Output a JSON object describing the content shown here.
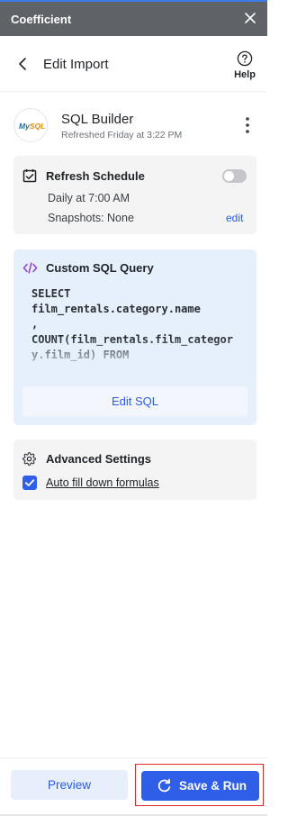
{
  "topbar": {
    "brand": "Coefficient"
  },
  "header": {
    "title": "Edit Import",
    "help_label": "Help"
  },
  "source": {
    "logo_text_a": "My",
    "logo_text_b": "SQL",
    "name": "SQL Builder",
    "subtitle": "Refreshed Friday at 3:22 PM"
  },
  "refresh": {
    "title": "Refresh Schedule",
    "schedule": "Daily at 7:00 AM",
    "snapshots": "Snapshots: None",
    "edit_label": "edit",
    "enabled": false
  },
  "sql": {
    "title": "Custom SQL Query",
    "query": "SELECT\nfilm_rentals.category.name\n,\nCOUNT(film_rentals.film_category.film_id) FROM",
    "edit_button": "Edit SQL"
  },
  "advanced": {
    "title": "Advanced Settings",
    "auto_fill_label": "Auto fill down formulas",
    "auto_fill_checked": true
  },
  "footer": {
    "preview_label": "Preview",
    "save_run_label": "Save & Run"
  },
  "colors": {
    "accent": "#2f5fe8",
    "link": "#2b5be6",
    "topbar": "#5f6368",
    "highlight": "#e02a2a"
  }
}
